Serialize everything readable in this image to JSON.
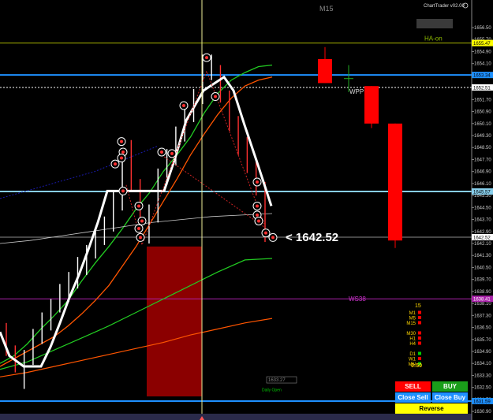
{
  "chart_data": {
    "type": "candlestick",
    "title": "",
    "timeframe_label": "M15",
    "indicator_name": "ChartTrader v02.00",
    "ylim": [
      1630.8,
      1657.5
    ],
    "y_ticks": [
      1656.5,
      1655.7,
      1654.9,
      1654.1,
      1653.3,
      1652.51,
      1651.7,
      1650.9,
      1650.1,
      1649.3,
      1648.5,
      1647.7,
      1646.9,
      1646.1,
      1645.3,
      1644.5,
      1643.7,
      1642.9,
      1642.1,
      1641.3,
      1640.5,
      1639.7,
      1638.9,
      1638.1,
      1637.3,
      1636.5,
      1635.7,
      1634.9,
      1634.1,
      1633.3,
      1632.5,
      1631.7,
      1630.9
    ],
    "y_tick_labels": [
      "1656.50",
      "1655.70",
      "1654.90",
      "1654.10",
      "1653.30",
      "1652.51",
      "1651.70",
      "1650.90",
      "1650.10",
      "1649.30",
      "1648.50",
      "1647.70",
      "1646.90",
      "1646.10",
      "1645.30",
      "1644.50",
      "1643.70",
      "1642.90",
      "1642.10",
      "1641.30",
      "1640.50",
      "1639.70",
      "1638.90",
      "1638.10",
      "1637.30",
      "1636.50",
      "1635.70",
      "1634.90",
      "1634.10",
      "1633.30",
      "1632.50",
      "1631.70",
      "1630.90"
    ],
    "current_price": 1642.52,
    "current_price_label": "<  1642.52",
    "price_tags": [
      {
        "value": 1655.47,
        "label": "1655.47",
        "bg": "#ffff00",
        "fg": "#000000"
      },
      {
        "value": 1653.34,
        "label": "1653.34",
        "bg": "#1e90ff",
        "fg": "#000000"
      },
      {
        "value": 1652.51,
        "label": "1652.51",
        "bg": "#ffffff",
        "fg": "#000000"
      },
      {
        "value": 1645.57,
        "label": "1645.57",
        "bg": "#87ceeb",
        "fg": "#000000"
      },
      {
        "value": 1642.52,
        "label": "1642.52",
        "bg": "#ffffff",
        "fg": "#000000"
      },
      {
        "value": 1638.41,
        "label": "1638.41",
        "bg": "#aa22aa",
        "fg": "#ffffff"
      },
      {
        "value": 1631.59,
        "label": "1631.59",
        "bg": "#1e90ff",
        "fg": "#000000"
      }
    ],
    "h_lines": [
      {
        "name": "HA-on",
        "value": 1655.47,
        "color": "#a8b400",
        "style": "solid"
      },
      {
        "name": "WPP",
        "value": 1652.51,
        "color": "#ffffff",
        "style": "dashed"
      },
      {
        "name": "blue-upper",
        "value": 1653.34,
        "color": "#1e90ff",
        "style": "solid"
      },
      {
        "name": "lightblue",
        "value": 1645.57,
        "color": "#87ceeb",
        "style": "solid"
      },
      {
        "name": "WS38",
        "value": 1638.41,
        "color": "#aa22aa",
        "style": "solid"
      },
      {
        "name": "blue-lower",
        "value": 1631.59,
        "color": "#1e90ff",
        "style": "solid"
      }
    ],
    "line_labels": [
      {
        "text": "HA-on",
        "value": 1655.47,
        "color": "#8fbc00"
      },
      {
        "text": "WPP",
        "value": 1652.51,
        "color": "#dddddd"
      },
      {
        "text": "WS38",
        "value": 1638.41,
        "color": "#cc33cc"
      }
    ],
    "htf_candles": [
      {
        "open": 1654.4,
        "close": 1652.8,
        "high": 1655.2,
        "low": 1652.8,
        "color": "#ff0000"
      },
      {
        "open": 1652.6,
        "close": 1650.1,
        "high": 1652.6,
        "low": 1649.8,
        "color": "#ff0000"
      },
      {
        "open": 1650.1,
        "close": 1642.3,
        "high": 1650.1,
        "low": 1641.8,
        "color": "#ff0000"
      }
    ],
    "bars": [
      {
        "o": 1636.3,
        "h": 1636.8,
        "l": 1634.6,
        "c": 1634.9
      },
      {
        "o": 1634.9,
        "h": 1635.3,
        "l": 1633.5,
        "c": 1633.9
      },
      {
        "o": 1633.9,
        "h": 1635.0,
        "l": 1632.4,
        "c": 1634.6
      },
      {
        "o": 1634.6,
        "h": 1636.4,
        "l": 1634.0,
        "c": 1635.9
      },
      {
        "o": 1635.9,
        "h": 1637.5,
        "l": 1635.4,
        "c": 1637.1
      },
      {
        "o": 1637.1,
        "h": 1638.4,
        "l": 1636.3,
        "c": 1637.9
      },
      {
        "o": 1637.9,
        "h": 1639.4,
        "l": 1637.5,
        "c": 1638.7
      },
      {
        "o": 1638.7,
        "h": 1640.2,
        "l": 1638.2,
        "c": 1639.6
      },
      {
        "o": 1639.6,
        "h": 1641.2,
        "l": 1639.1,
        "c": 1640.5
      },
      {
        "o": 1640.5,
        "h": 1642.0,
        "l": 1640.0,
        "c": 1641.4
      },
      {
        "o": 1641.4,
        "h": 1643.0,
        "l": 1641.1,
        "c": 1642.4
      },
      {
        "o": 1642.4,
        "h": 1643.9,
        "l": 1642.0,
        "c": 1643.3
      },
      {
        "o": 1643.3,
        "h": 1645.6,
        "l": 1642.9,
        "c": 1644.8
      },
      {
        "o": 1644.8,
        "h": 1648.3,
        "l": 1644.3,
        "c": 1647.3
      },
      {
        "o": 1647.3,
        "h": 1649.0,
        "l": 1645.6,
        "c": 1646.1
      },
      {
        "o": 1646.1,
        "h": 1646.4,
        "l": 1642.4,
        "c": 1643.1
      },
      {
        "o": 1643.1,
        "h": 1644.7,
        "l": 1642.1,
        "c": 1644.0
      },
      {
        "o": 1644.0,
        "h": 1647.1,
        "l": 1643.5,
        "c": 1646.6
      },
      {
        "o": 1646.6,
        "h": 1648.4,
        "l": 1646.0,
        "c": 1647.9
      },
      {
        "o": 1647.9,
        "h": 1649.9,
        "l": 1647.3,
        "c": 1649.4
      },
      {
        "o": 1649.4,
        "h": 1651.3,
        "l": 1648.9,
        "c": 1650.7
      },
      {
        "o": 1650.7,
        "h": 1652.4,
        "l": 1650.2,
        "c": 1651.8
      },
      {
        "o": 1651.8,
        "h": 1654.7,
        "l": 1651.4,
        "c": 1653.6
      },
      {
        "o": 1653.6,
        "h": 1654.7,
        "l": 1653.0,
        "c": 1653.9
      },
      {
        "o": 1653.9,
        "h": 1654.0,
        "l": 1651.5,
        "c": 1652.0
      },
      {
        "o": 1652.0,
        "h": 1652.3,
        "l": 1649.6,
        "c": 1650.3
      },
      {
        "o": 1650.3,
        "h": 1650.6,
        "l": 1648.0,
        "c": 1648.8
      },
      {
        "o": 1648.8,
        "h": 1649.2,
        "l": 1646.8,
        "c": 1647.5
      },
      {
        "o": 1647.5,
        "h": 1647.8,
        "l": 1645.3,
        "c": 1645.9
      },
      {
        "o": 1645.9,
        "h": 1646.2,
        "l": 1642.2,
        "c": 1642.6
      }
    ],
    "ha_line": [
      1636.2,
      1634.6,
      1633.9,
      1633.9,
      1635.2,
      1636.8,
      1638.5,
      1640.0,
      1641.7,
      1643.5,
      1645.6,
      1645.6,
      1645.6,
      1645.6,
      1647.8,
      1650.3,
      1652.3,
      1653.2,
      1652.3,
      1650.0,
      1647.5,
      1644.6
    ],
    "ma_fast_green": [
      1634.1,
      1634.6,
      1635.4,
      1636.4,
      1637.3,
      1638.3,
      1639.6,
      1640.8,
      1641.9,
      1643.1,
      1644.4,
      1645.5,
      1646.9,
      1648.0,
      1649.2,
      1650.8,
      1652.1,
      1653.0,
      1653.5,
      1653.9,
      1654.0
    ],
    "ma_orange": [
      1633.9,
      1634.4,
      1634.9,
      1635.4,
      1635.9,
      1636.6,
      1637.4,
      1638.3,
      1639.3,
      1640.6,
      1641.9,
      1643.4,
      1644.9,
      1646.4,
      1648.0,
      1649.4,
      1650.7,
      1651.8,
      1652.6,
      1653.0,
      1653.2
    ],
    "ma_low_green": [
      1633.7,
      1634.2,
      1635.0,
      1635.8,
      1636.6,
      1637.5,
      1638.4,
      1639.3,
      1640.2,
      1641.0,
      1641.1
    ],
    "ma_low_orange": [
      1633.2,
      1633.5,
      1633.9,
      1634.3,
      1634.7,
      1635.1,
      1635.5,
      1636.0,
      1636.4,
      1636.8,
      1637.1
    ],
    "ma_gray": [
      1642.1,
      1642.3,
      1642.6,
      1642.9,
      1643.2,
      1643.5,
      1643.7,
      1643.9,
      1644.0,
      1644.1
    ],
    "shaded_box": {
      "top": 1641.9,
      "bottom": 1631.9,
      "color": "#8b0000"
    },
    "box_label": "1633.27",
    "daily_open_label": "Daily Open"
  },
  "panel": {
    "ws_label": "WS38",
    "count": "15",
    "tf_rows": [
      {
        "label": "M1",
        "color": "#ff0000"
      },
      {
        "label": "M5",
        "color": "#ff0000"
      },
      {
        "label": "M15",
        "color": "#ff0000"
      },
      {
        "label": "",
        "color": ""
      },
      {
        "label": "M30",
        "color": "#ff0000"
      },
      {
        "label": "H1",
        "color": "#ff0000"
      },
      {
        "label": "H4",
        "color": "#ff0000"
      },
      {
        "label": "",
        "color": ""
      },
      {
        "label": "D1",
        "color": "#00cc00"
      },
      {
        "label": "W1",
        "color": "#ff0000"
      },
      {
        "label": "MN",
        "color": "#00cc00"
      }
    ],
    "timer": "0:50"
  },
  "buttons": {
    "sell": "SELL",
    "buy": "BUY",
    "close_sell": "Close Sell",
    "close_buy": "Close Buy",
    "reverse": "Reverse"
  },
  "colors": {
    "sell": "#ff0000",
    "buy": "#1a9e1a",
    "close": "#1e90ff",
    "reverse": "#ffff00"
  }
}
